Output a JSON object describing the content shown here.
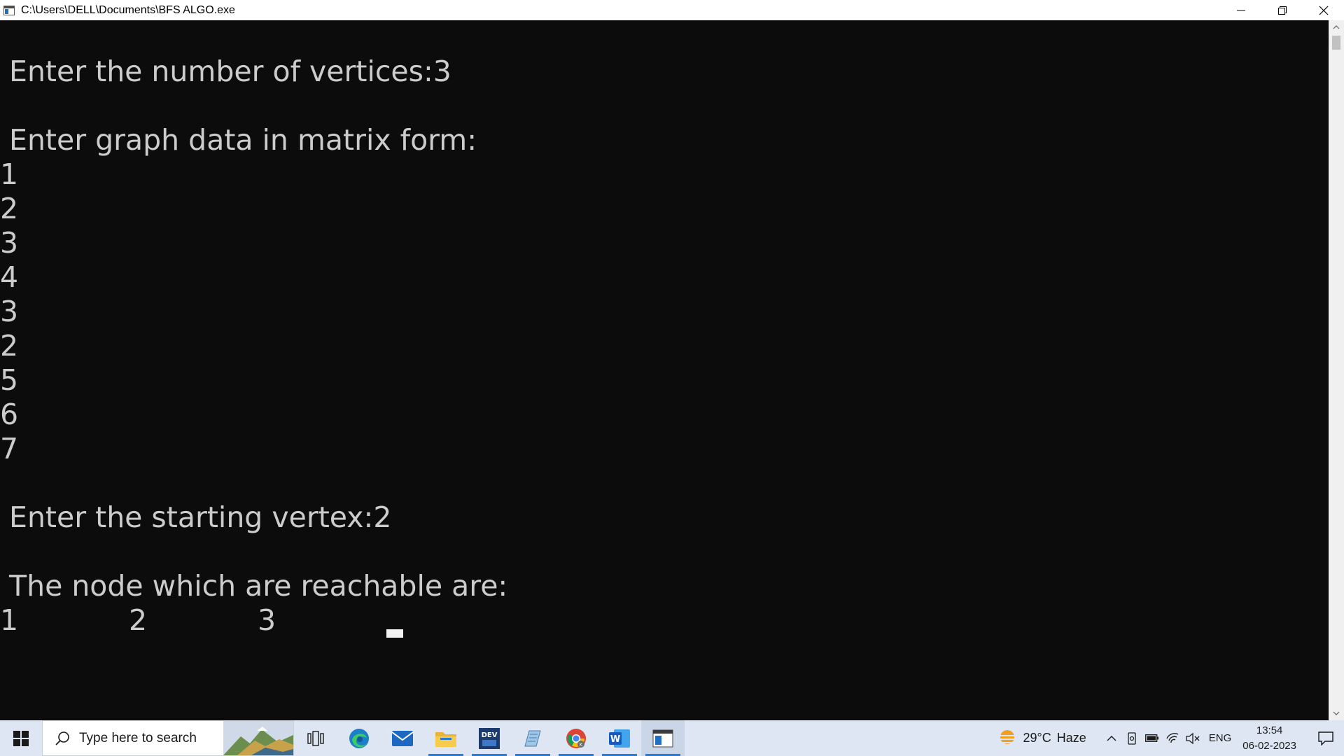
{
  "window": {
    "title": "C:\\Users\\DELL\\Documents\\BFS ALGO.exe"
  },
  "console": {
    "prompt_vertices": " Enter the number of vertices:3",
    "prompt_matrix": " Enter graph data in matrix form:",
    "matrix_inputs": [
      "1",
      "2",
      "3",
      "4",
      "3",
      "2",
      "5",
      "6",
      "7"
    ],
    "prompt_start": " Enter the starting vertex:2",
    "result_label": " The node which are reachable are:",
    "reachable_nodes": [
      "1",
      "2",
      "3"
    ]
  },
  "taskbar": {
    "search_placeholder": "Type here to search",
    "apps": [
      "task-view",
      "edge",
      "mail",
      "file-explorer",
      "dev-cpp",
      "notepad",
      "chrome",
      "word",
      "console"
    ],
    "weather": {
      "temperature": "29°C",
      "condition": "Haze"
    },
    "language": "ENG",
    "time": "13:54",
    "date": "06-02-2023"
  },
  "colors": {
    "console_bg": "#0c0c0c",
    "console_text": "#cccccc",
    "taskbar_bg": "#dde6f2",
    "accent": "#2a7bd6"
  }
}
